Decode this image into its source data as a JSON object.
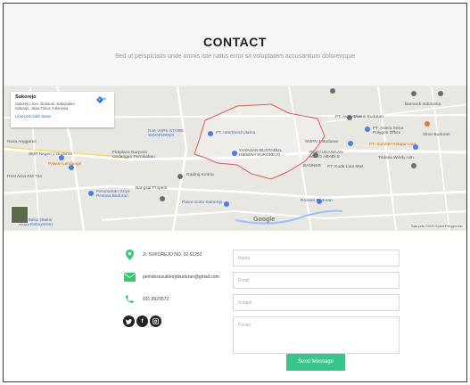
{
  "header": {
    "title": "CONTACT",
    "subtitle": "Sed ut perspiciatis unde omnis iste natus error sit voluptatem accusantium doloremque"
  },
  "map": {
    "place_name": "Sukorejo",
    "place_address": "Sukorejo, Kec. Buduran, Kabupaten Sidoarjo, Jawa Timur, Indonesia",
    "route_label": "Rute",
    "larger_map_link": "Lihat peta lebih besar",
    "labels": {
      "pt_intertrend": "PT. Intertrend Utama",
      "yayasan": "YAYASAN BUSTANUL HIKMAH SUKOREJO...",
      "sma1": "SMPN 1 Buduran",
      "pergudangan": "PERGUDANGAN MEKO ABADI 5",
      "banner": "BANNER",
      "kuda": "PT. Kuda Laut Mas",
      "rja": "RJA VAPE STORE SIDOPURNO",
      "fireplace": "Fireplace Nuryeon Undangan Pernikahan",
      "gading": "Gading Kirana",
      "bangsal": "Bangsal Properti",
      "pasar": "Pasar Sono Sukorejo",
      "rossari": "Rossari Buduran",
      "smp2": "SMP Negeri 2 Buduran",
      "pawon": "Pawon Lendange",
      "rest_area": "Rest Area KM 754",
      "perumahan": "Perumahan Griya Pesona Buduran",
      "citra": "Citra Bakul (Bakul Tenya Kebayoran)",
      "barnardi": "Barnardi Indonesia",
      "avia": "PT. Avia Avian",
      "pusak": "Pusak Buduran",
      "asri": "PT. Asiera Sena Polygon Office",
      "sinar": "Sinar Buduran",
      "sumber": "PT. Sumber Kelapa Laut",
      "tridesa": "Tridesa Windy Alm",
      "nusa": "Nusa Anggaran",
      "google": "Google",
      "footer": "Data peta ©2020  Syarat Penggunaan"
    }
  },
  "contact": {
    "address": "Jl. SUKOREJO NO. 32 61252",
    "email": "pemdesusukorejobuduran@gmail.com",
    "phone": "031 8929572"
  },
  "form": {
    "name_placeholder": "Nama",
    "email_placeholder": "Email",
    "subject_placeholder": "Subjek",
    "message_placeholder": "Pesan",
    "submit_label": "Send Message"
  },
  "colors": {
    "accent": "#37c68a",
    "icon_green": "#2ecc71",
    "map_boundary": "#e05a5a"
  }
}
